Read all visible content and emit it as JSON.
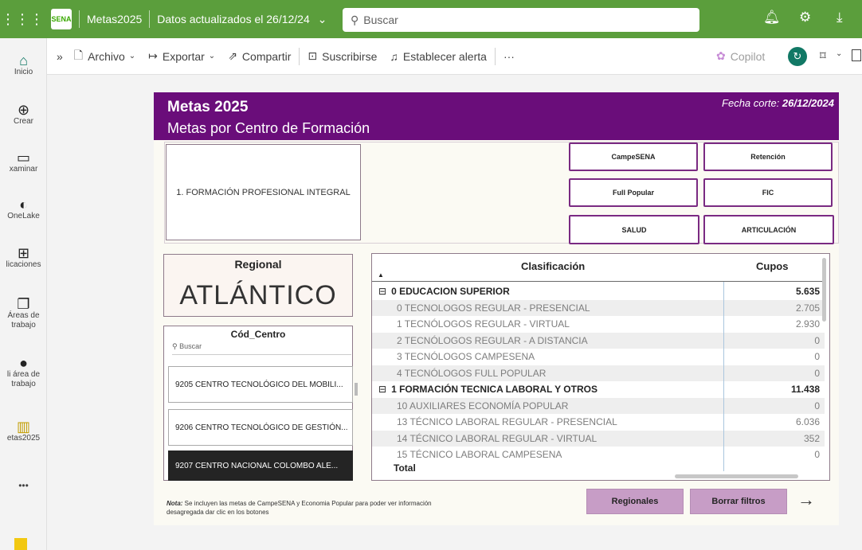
{
  "topbar": {
    "app_name": "Metas2025",
    "updated": "Datos actualizados el 26/12/24",
    "updated_chevron": "⌄",
    "search_placeholder": "Buscar"
  },
  "rail": {
    "items": [
      {
        "label": "Inicio",
        "icon": "home-icon"
      },
      {
        "label": "Crear",
        "icon": "plus-circle-icon"
      },
      {
        "label": "xaminar",
        "icon": "folder-icon"
      },
      {
        "label": "OneLake",
        "icon": "onelake-icon"
      },
      {
        "label": "licaciones",
        "icon": "apps-icon"
      },
      {
        "label": "Áreas de trabajo",
        "icon": "workspaces-icon"
      },
      {
        "label": "li área de trabajo",
        "icon": "avatar-icon"
      },
      {
        "label": "etas2025",
        "icon": "report-icon"
      }
    ],
    "more": "•••"
  },
  "cmdbar": {
    "expand": "»",
    "archivo": "Archivo",
    "exportar": "Exportar",
    "compartir": "Compartir",
    "suscribirse": "Suscribirse",
    "alerta": "Establecer alerta",
    "more": "···",
    "copilot": "Copilot"
  },
  "report": {
    "title": "Metas 2025",
    "subtitle": "Metas por Centro de Formación",
    "date_label": "Fecha corte:",
    "date_value": "26/12/2024",
    "slicer_main": "1. FORMACIÓN PROFESIONAL INTEGRAL",
    "buttons": {
      "campesena": "CampeSENA",
      "retencion": "Retención",
      "full_popular": "Full Popular",
      "fic": "FIC",
      "salud": "SALUD",
      "articulacion": "ARTICULACIÓN"
    },
    "regional": {
      "label": "Regional",
      "value": "ATLÁNTICO"
    },
    "centro": {
      "label": "Cód_Centro",
      "search": "Buscar",
      "items": [
        "9205 CENTRO TECNOLÓGICO DEL MOBILI...",
        "9206 CENTRO TECNOLÓGICO DE GESTIÓN...",
        "9207 CENTRO NACIONAL COLOMBO ALE..."
      ]
    },
    "table": {
      "col_clasificacion": "Clasificación",
      "col_cupos": "Cupos",
      "total_label": "Total",
      "rows": [
        {
          "label": "0 EDUCACION SUPERIOR",
          "value": "5.635",
          "group": true,
          "toggle": "⊟"
        },
        {
          "label": "0 TECNOLOGOS REGULAR - PRESENCIAL",
          "value": "2.705"
        },
        {
          "label": "1 TECNÓLOGOS REGULAR - VIRTUAL",
          "value": "2.930"
        },
        {
          "label": "2 TECNÓLOGOS REGULAR - A DISTANCIA",
          "value": "0"
        },
        {
          "label": "3 TECNÓLOGOS CAMPESENA",
          "value": "0"
        },
        {
          "label": "4 TECNÓLOGOS FULL POPULAR",
          "value": "0"
        },
        {
          "label": "1 FORMACIÓN TECNICA LABORAL Y OTROS",
          "value": "11.438",
          "group": true,
          "toggle": "⊟"
        },
        {
          "label": "10 AUXILIARES ECONOMÍA POPULAR",
          "value": "0"
        },
        {
          "label": "13 TÉCNICO LABORAL REGULAR - PRESENCIAL",
          "value": "6.036"
        },
        {
          "label": "14 TÉCNICO LABORAL REGULAR - VIRTUAL",
          "value": "352"
        },
        {
          "label": "15 TÉCNICO LABORAL CAMPESENA",
          "value": "0"
        }
      ]
    },
    "nota_label": "Nota:",
    "nota_text": " Se incluyen las metas de CampeSENA y Economia Popular para poder ver información desagregada dar clic en los botones",
    "regionales_button": "Regionales",
    "borrar_button": "Borrar filtros",
    "next_arrow": "→"
  }
}
